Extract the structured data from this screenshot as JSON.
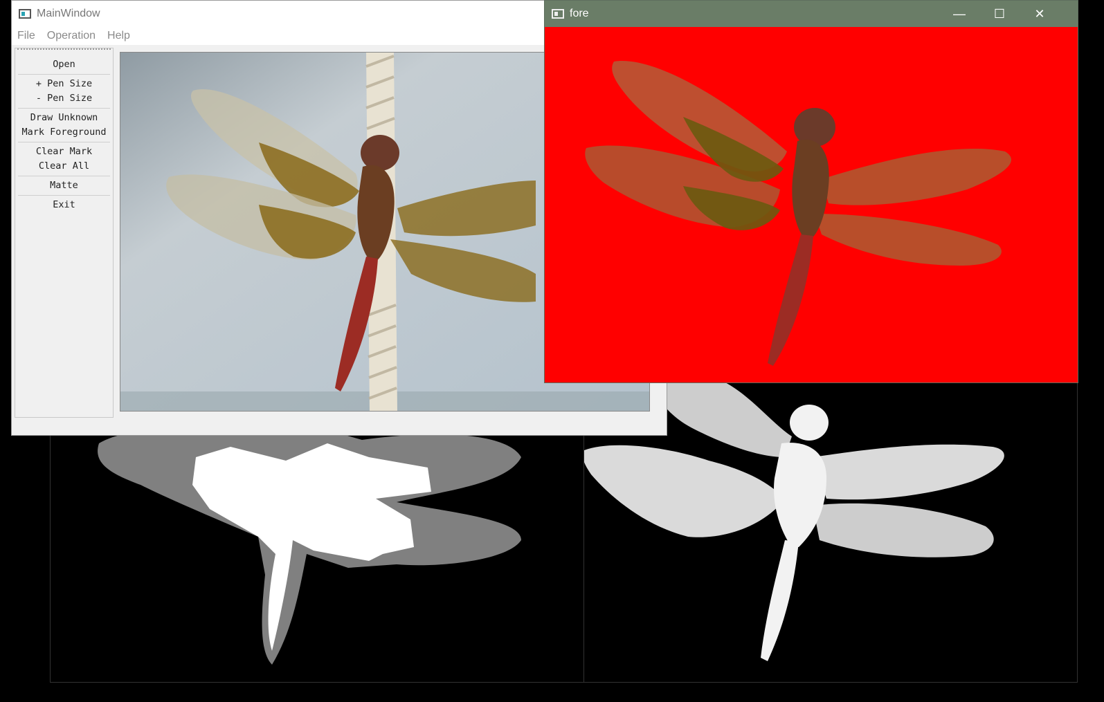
{
  "colors": {
    "fore_titlebar": "#6a7d67",
    "fore_background": "#ff0000",
    "trimap_unknown": "#808080",
    "trimap_foreground": "#ffffff",
    "desktop": "#000000"
  },
  "main_window": {
    "title": "MainWindow",
    "menu": [
      "File",
      "Operation",
      "Help"
    ],
    "toolbox": {
      "open": "Open",
      "pen_size_plus": "+ Pen Size",
      "pen_size_minus": "- Pen Size",
      "draw_unknown": "Draw Unknown",
      "mark_foreground": "Mark Foreground",
      "clear_mark": "Clear Mark",
      "clear_all": "Clear All",
      "matte": "Matte",
      "exit": "Exit"
    }
  },
  "fore_window": {
    "title": "fore",
    "minimize_icon": "minimize-icon",
    "maximize_icon": "maximize-icon",
    "close_icon": "close-icon"
  }
}
